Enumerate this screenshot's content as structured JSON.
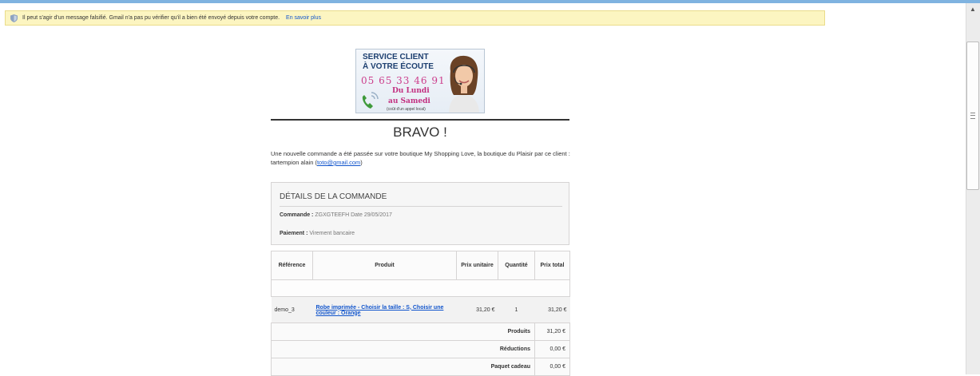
{
  "warning": {
    "message": "Il peut s'agir d'un message falsifié. Gmail n'a pas pu vérifier qu'il a bien été envoyé depuis votre compte.",
    "link": "En savoir plus"
  },
  "service_banner": {
    "line1": "SERVICE CLIENT",
    "line2": "À VOTRE ÉCOUTE",
    "phone": "05 65 33 46 91",
    "days_line1": "Du Lundi",
    "days_line2": "au Samedi",
    "note": "(coût d'un appel local)"
  },
  "heading": "BRAVO !",
  "intro": {
    "text": "Une nouvelle commande a été passée sur votre boutique My Shopping Love, la boutique du Plaisir par ce client : tartempion alain (",
    "email": "toto@gmail.com",
    "close": ")"
  },
  "details": {
    "title": "DÉTAILS DE LA COMMANDE",
    "order_label": "Commande :",
    "order_value": "ZGXGTEEFH Date 29/05/2017",
    "payment_label": "Paiement :",
    "payment_value": "Virement bancaire"
  },
  "table": {
    "headers": [
      "Référence",
      "Produit",
      "Prix unitaire",
      "Quantité",
      "Prix total"
    ],
    "rows": [
      {
        "reference": "demo_3",
        "product": "Robe imprimée - Choisir la taille : S, Choisir une couleur : Orange",
        "unit_price": "31,20 €",
        "quantity": "1",
        "total": "31,20 €"
      }
    ]
  },
  "totals": [
    {
      "label": "Produits",
      "value": "31,20 €"
    },
    {
      "label": "Réductions",
      "value": "0,00 €"
    },
    {
      "label": "Paquet cadeau",
      "value": "0,00 €"
    }
  ]
}
